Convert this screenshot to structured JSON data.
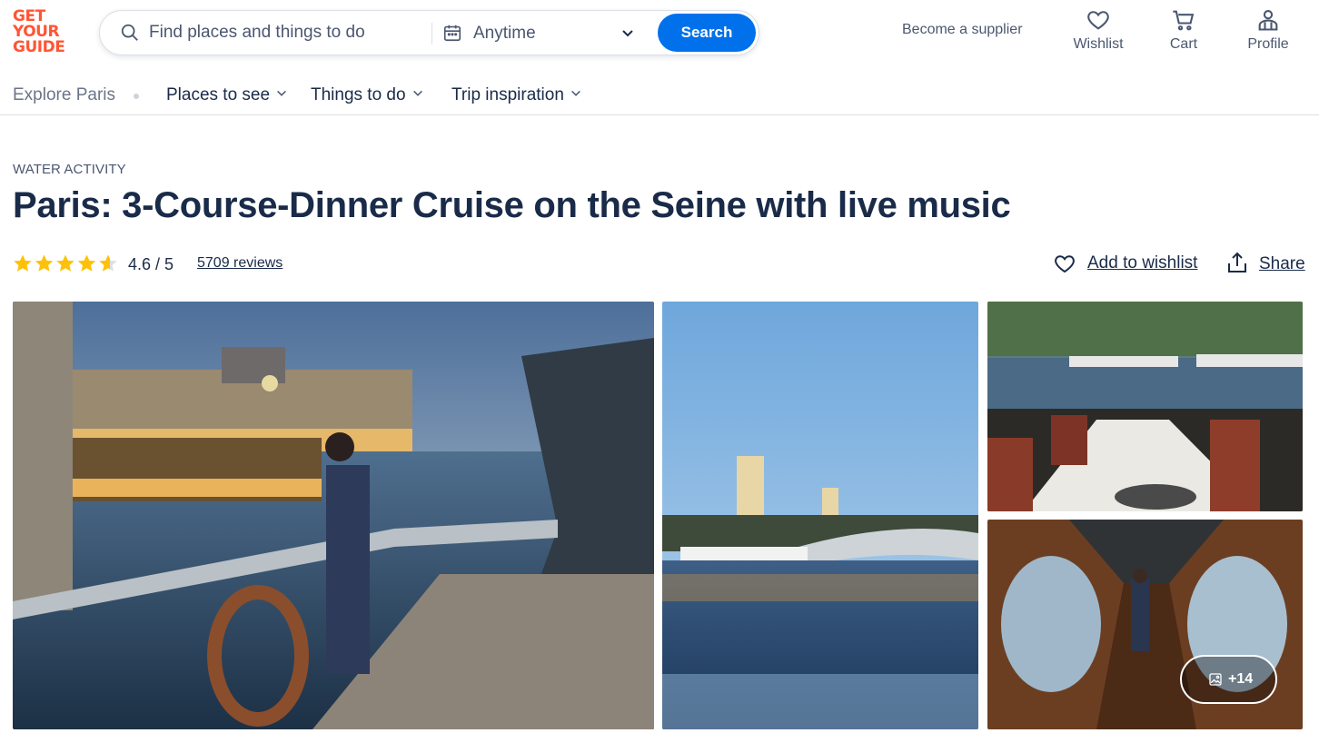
{
  "brand": {
    "logo_lines": [
      "GET",
      "YOUR",
      "GUIDE"
    ],
    "color": "#ff5533"
  },
  "search": {
    "placeholder": "Find places and things to do",
    "value": "",
    "date_label": "Anytime",
    "button_label": "Search",
    "accent": "#0071eb"
  },
  "header": {
    "supplier_link": "Become a supplier",
    "actions": [
      {
        "label": "Wishlist",
        "icon": "heart-icon"
      },
      {
        "label": "Cart",
        "icon": "cart-icon"
      },
      {
        "label": "Profile",
        "icon": "profile-icon"
      }
    ]
  },
  "subnav": {
    "explore": "Explore Paris",
    "items": [
      {
        "label": "Places to see"
      },
      {
        "label": "Things to do"
      },
      {
        "label": "Trip inspiration"
      }
    ]
  },
  "activity": {
    "category": "WATER ACTIVITY",
    "title": "Paris: 3-Course-Dinner Cruise on the Seine with live music",
    "rating": 4.6,
    "rating_text": "4.6 / 5",
    "reviews": "5709 reviews",
    "star_color": "#ffc107",
    "add_to_wishlist": "Add to wishlist",
    "share": "Share"
  },
  "gallery": {
    "more_photos": "+14",
    "photos": [
      "cruise-deck-orsay",
      "alexandre-iii-bridge",
      "dining-table-window",
      "dining-corridor"
    ]
  }
}
